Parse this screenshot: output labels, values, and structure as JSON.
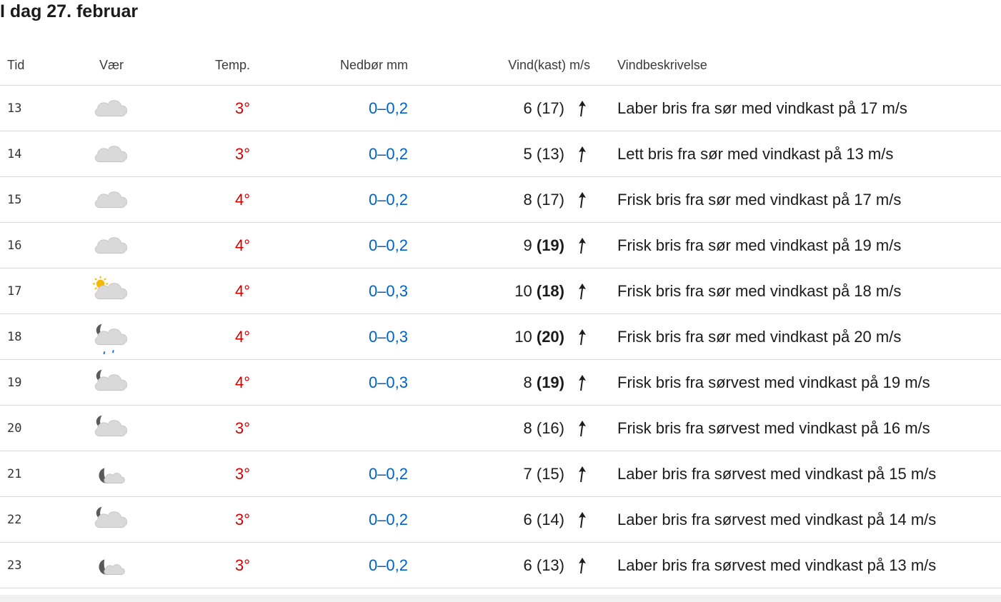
{
  "title": "I dag 27. februar",
  "headers": {
    "time": "Tid",
    "weather": "Vær",
    "temp": "Temp.",
    "precip": "Nedbør mm",
    "wind": "Vind(kast) m/s",
    "desc": "Vindbeskrivelse"
  },
  "colors": {
    "temperature": "#d40000",
    "precipitation": "#0062c3",
    "divider": "#d8d8d8"
  },
  "rows": [
    {
      "time": "13",
      "icon": "cloudy-icon",
      "temp": "3°",
      "precip": "0–0,2",
      "wind": "6",
      "gust": "(17)",
      "gust_strong": false,
      "desc": "Laber bris fra sør med vindkast på 17 m/s"
    },
    {
      "time": "14",
      "icon": "cloudy-icon",
      "temp": "3°",
      "precip": "0–0,2",
      "wind": "5",
      "gust": "(13)",
      "gust_strong": false,
      "desc": "Lett bris fra sør med vindkast på 13 m/s"
    },
    {
      "time": "15",
      "icon": "cloudy-icon",
      "temp": "4°",
      "precip": "0–0,2",
      "wind": "8",
      "gust": "(17)",
      "gust_strong": false,
      "desc": "Frisk bris fra sør med vindkast på 17 m/s"
    },
    {
      "time": "16",
      "icon": "cloudy-icon",
      "temp": "4°",
      "precip": "0–0,2",
      "wind": "9",
      "gust": "(19)",
      "gust_strong": true,
      "desc": "Frisk bris fra sør med vindkast på 19 m/s"
    },
    {
      "time": "17",
      "icon": "partly-cloudy-day-icon",
      "temp": "4°",
      "precip": "0–0,3",
      "wind": "10",
      "gust": "(18)",
      "gust_strong": true,
      "desc": "Frisk bris fra sør med vindkast på 18 m/s"
    },
    {
      "time": "18",
      "icon": "light-rain-night-icon",
      "temp": "4°",
      "precip": "0–0,3",
      "wind": "10",
      "gust": "(20)",
      "gust_strong": true,
      "desc": "Frisk bris fra sør med vindkast på 20 m/s"
    },
    {
      "time": "19",
      "icon": "partly-cloudy-night-icon",
      "temp": "4°",
      "precip": "0–0,3",
      "wind": "8",
      "gust": "(19)",
      "gust_strong": true,
      "desc": "Frisk bris fra sørvest med vindkast på 19 m/s"
    },
    {
      "time": "20",
      "icon": "partly-cloudy-night-icon",
      "temp": "3°",
      "precip": "",
      "wind": "8",
      "gust": "(16)",
      "gust_strong": false,
      "desc": "Frisk bris fra sørvest med vindkast på 16 m/s"
    },
    {
      "time": "21",
      "icon": "fair-night-icon",
      "temp": "3°",
      "precip": "0–0,2",
      "wind": "7",
      "gust": "(15)",
      "gust_strong": false,
      "desc": "Laber bris fra sørvest med vindkast på 15 m/s"
    },
    {
      "time": "22",
      "icon": "partly-cloudy-night-icon",
      "temp": "3°",
      "precip": "0–0,2",
      "wind": "6",
      "gust": "(14)",
      "gust_strong": false,
      "desc": "Laber bris fra sørvest med vindkast på 14 m/s"
    },
    {
      "time": "23",
      "icon": "fair-night-icon",
      "temp": "3°",
      "precip": "0–0,2",
      "wind": "6",
      "gust": "(13)",
      "gust_strong": false,
      "desc": "Laber bris fra sørvest med vindkast på 13 m/s"
    }
  ]
}
